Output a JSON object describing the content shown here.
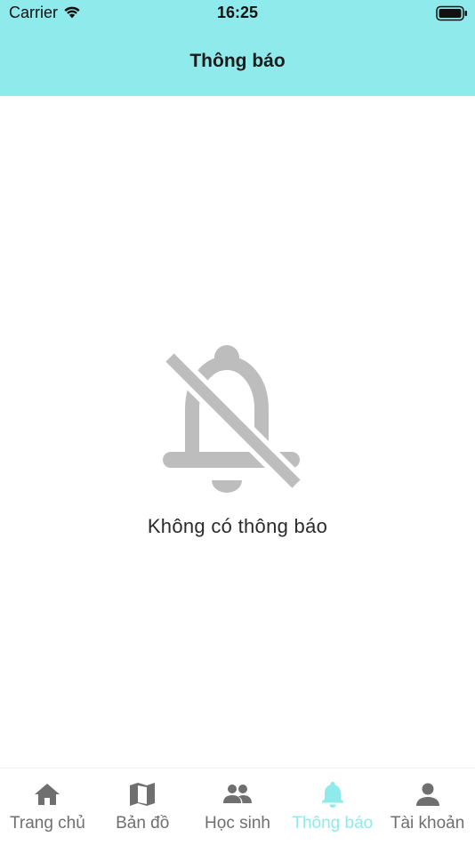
{
  "status_bar": {
    "carrier": "Carrier",
    "time": "16:25",
    "wifi_icon": "wifi-icon",
    "battery_icon": "battery-icon"
  },
  "header": {
    "title": "Thông báo",
    "background_color": "#8FEBEB"
  },
  "empty_state": {
    "icon": "bell-off-icon",
    "message": "Không có thông báo"
  },
  "tab_bar": {
    "active_color": "#8FEBEB",
    "inactive_color": "#6F6F6F",
    "tabs": [
      {
        "label": "Trang chủ",
        "icon": "home-icon",
        "active": false
      },
      {
        "label": "Bản đồ",
        "icon": "map-icon",
        "active": false
      },
      {
        "label": "Học sinh",
        "icon": "people-icon",
        "active": false
      },
      {
        "label": "Thông báo",
        "icon": "bell-icon",
        "active": true
      },
      {
        "label": "Tài khoản",
        "icon": "person-icon",
        "active": false
      }
    ]
  }
}
